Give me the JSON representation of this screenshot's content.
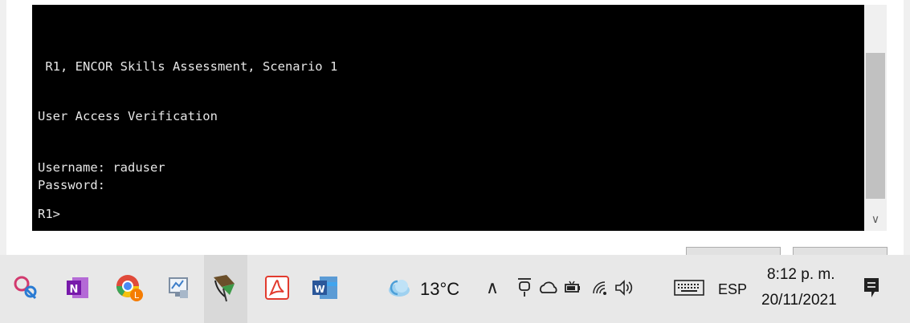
{
  "terminal": {
    "lines": [
      " R1, ENCOR Skills Assessment, Scenario 1",
      "User Access Verification",
      "Username: raduser",
      "Password:",
      "R1>"
    ]
  },
  "scrollbar": {
    "down_arrow": "∨"
  },
  "taskbar": {
    "apps": [
      {
        "name": "snipping-tool-icon"
      },
      {
        "name": "onenote-icon",
        "glyph": "N"
      },
      {
        "name": "chrome-icon",
        "glyph": "L"
      },
      {
        "name": "system-monitor-icon"
      },
      {
        "name": "network-tool-icon"
      },
      {
        "name": "acrobat-icon"
      },
      {
        "name": "word-icon",
        "glyph": "W"
      }
    ],
    "weather": {
      "temperature": "13°C"
    },
    "tray": {
      "chevron": "∧",
      "language": "ESP",
      "time": "8:12 p. m.",
      "date": "20/11/2021"
    }
  },
  "colors": {
    "terminal_bg": "#000000",
    "terminal_fg": "#e6e6e6",
    "taskbar_bg": "#e8e8e8"
  }
}
